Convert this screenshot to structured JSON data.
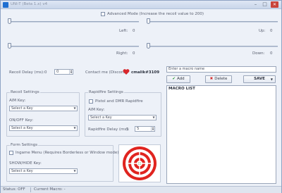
{
  "window": {
    "title": "UNI-T (Beta 1.x) v4",
    "minimize": "–",
    "maximize": "□",
    "close": "✕"
  },
  "advanced_mode": {
    "label": "Advanced Mode (Increase the recoil value to 200)",
    "checked": false
  },
  "sliders": {
    "left": {
      "label": "Left:",
      "value": "0",
      "level": 0
    },
    "up": {
      "label": "Up:",
      "value": "0",
      "level": 0
    },
    "right": {
      "label": "Right:",
      "value": "0",
      "level": 0
    },
    "down": {
      "label": "Down:",
      "value": "0",
      "level": 0
    }
  },
  "recoil_delay": {
    "label": "Recoil Delay (ms):",
    "value": "0",
    "spin_value": "0"
  },
  "contact": {
    "label": "Contact me (Discord):",
    "handle": "cmalik#3109"
  },
  "macro": {
    "name_placeholder": "Enter a macro name",
    "add_label": "Add",
    "delete_label": "Delete",
    "save_label": "SAVE",
    "list_title": "MACRO LIST"
  },
  "recoil_settings": {
    "title": "Recoil Settings",
    "aim_key_label": "AIM Key:",
    "aim_key_value": "Select a Key",
    "onoff_key_label": "ON/OFF Key:",
    "onoff_key_value": "Select a Key"
  },
  "rapidfire_settings": {
    "title": "Rapidfire Settings",
    "pistol_label": "Pistol and DMR Rapidfire",
    "aim_key_label": "AIM Key:",
    "aim_key_value": "Select a Key",
    "delay_label": "Rapidfire Delay (ms):",
    "delay_value": "5",
    "delay_spin": "5"
  },
  "form_settings": {
    "title": "Form Settings",
    "ingame_label": "Ingame Menu (Requires Borderless or Window mode)",
    "showhide_label": "SHOW/HIDE Key:",
    "showhide_value": "Select a Key"
  },
  "status": {
    "status_text": "Status: OFF",
    "macro_text": "Current Macro: -"
  },
  "colors": {
    "accent": "#1f6fd1",
    "heart": "#d8262b",
    "target_red": "#e0241f"
  }
}
